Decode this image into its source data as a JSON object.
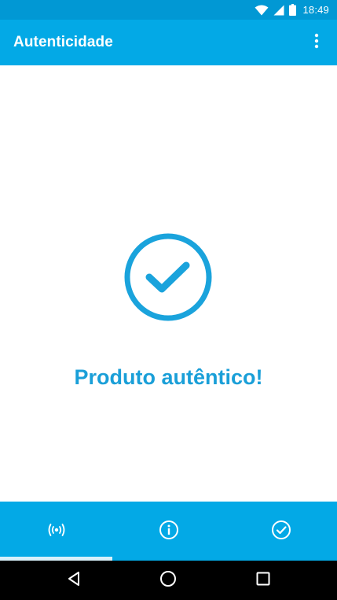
{
  "status_bar": {
    "time": "18:49",
    "icons": [
      "wifi-icon",
      "signal-icon",
      "battery-icon"
    ]
  },
  "app_bar": {
    "title": "Autenticidade",
    "overflow_icon": "more-vert-icon"
  },
  "result": {
    "icon": "check-circle-icon",
    "message": "Produto autêntico!"
  },
  "bottom_nav": {
    "tabs": [
      {
        "icon": "nfc-scan-icon",
        "selected": true
      },
      {
        "icon": "info-icon",
        "selected": false
      },
      {
        "icon": "check-circle-icon",
        "selected": false
      }
    ]
  },
  "system_nav": {
    "buttons": [
      "back-icon",
      "home-icon",
      "recents-icon"
    ]
  },
  "colors": {
    "status_bar": "#0198d4",
    "primary": "#03a9e6",
    "accent_text": "#1a9fd8",
    "check_stroke": "#1aa3dc",
    "tab_indicator": "#d8f1fb",
    "system_nav": "#000000"
  }
}
